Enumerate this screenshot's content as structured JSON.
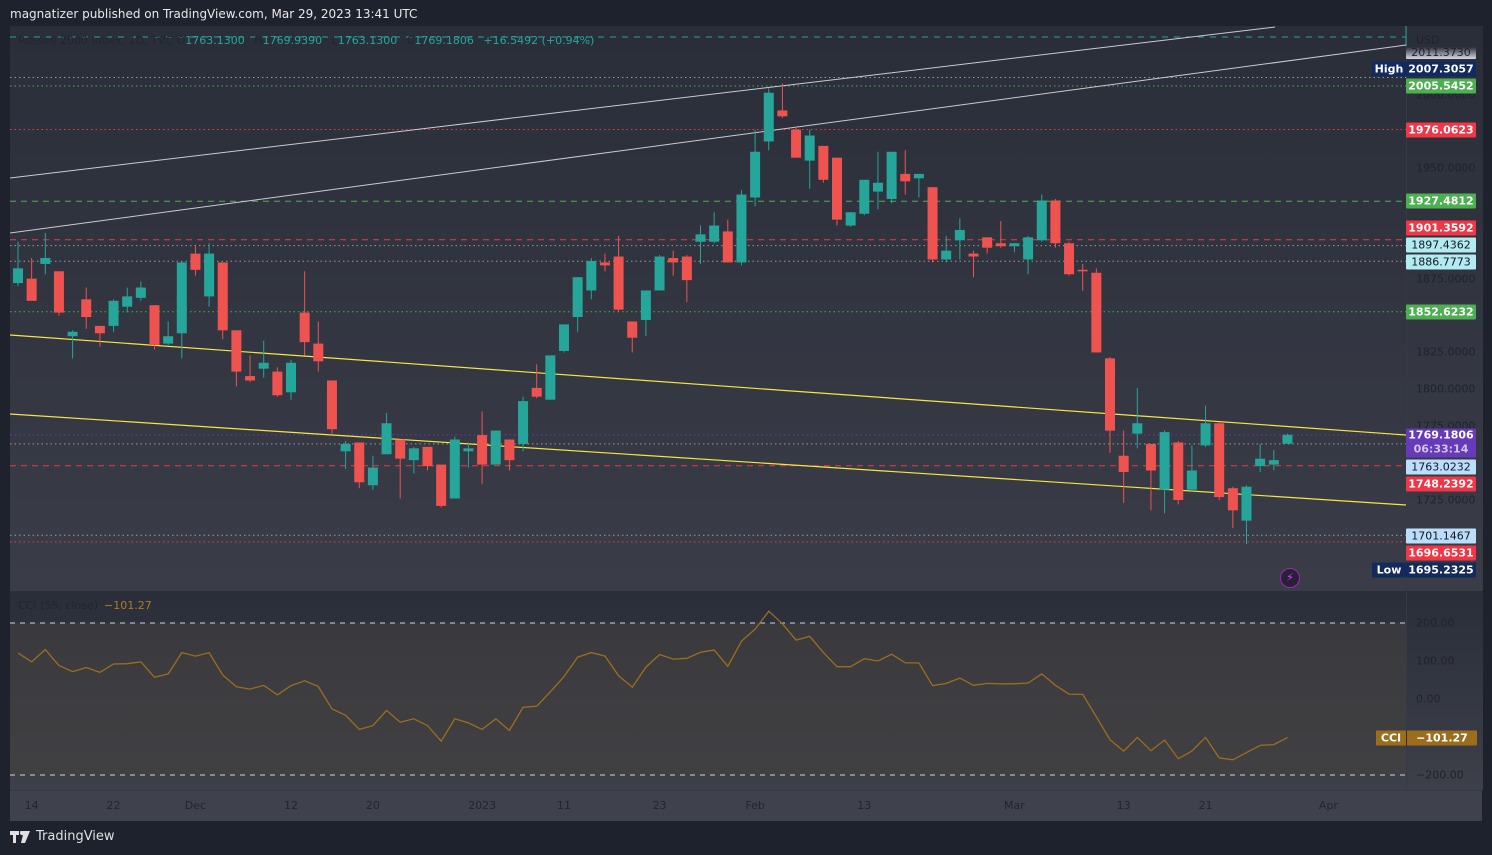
{
  "header": {
    "publish_text": "magnatizer published on TradingView.com, Mar 29, 2023 13:41 UTC"
  },
  "legend": {
    "symbol": "Russell 2000 Index, 1D, TVC",
    "o_label": "O",
    "open": "1763.1300",
    "h_label": "H",
    "high": "1769.9390",
    "l_label": "L",
    "low": "1763.1300",
    "c_label": "C",
    "close": "1769.1806",
    "change": "+16.5492 (+0.94%)"
  },
  "price_axis": {
    "currency": "USD",
    "ticks": [
      "2011.3730",
      "2000.0000",
      "1950.0000",
      "1875.0000",
      "1825.0000",
      "1800.0000",
      "1775.0000",
      "1725.0000"
    ],
    "badges": {
      "high_tag": "High",
      "high": "2007.3057",
      "b2005": "2005.5452",
      "b1976": "1976.0623",
      "b1927": "1927.4812",
      "b1901": "1901.3592",
      "b1897": "1897.4362",
      "b1886": "1886.7773",
      "b1852": "1852.6232",
      "last": "1769.1806",
      "countdown": "06:33:14",
      "b1763": "1763.0232",
      "b1748": "1748.2392",
      "b1701": "1701.1467",
      "b1696": "1696.6531",
      "low_tag": "Low",
      "low": "1695.2325"
    }
  },
  "colors": {
    "up": "#26a69a",
    "down": "#ef5350",
    "cci": "#9c6d1c",
    "accent_purple": "#673ab7"
  },
  "cci": {
    "legend_label": "CCI (55, close)",
    "legend_value": "−101.27",
    "axis_ticks": [
      "200.00",
      "100.00",
      "0.00",
      "−200.00"
    ],
    "badge_tag": "CCI",
    "badge_value": "−101.27"
  },
  "time_axis": {
    "labels": [
      {
        "text": "14",
        "index": 1
      },
      {
        "text": "22",
        "index": 7
      },
      {
        "text": "Dec",
        "index": 13
      },
      {
        "text": "12",
        "index": 20
      },
      {
        "text": "20",
        "index": 26
      },
      {
        "text": "2023",
        "index": 34
      },
      {
        "text": "11",
        "index": 40
      },
      {
        "text": "23",
        "index": 47
      },
      {
        "text": "Feb",
        "index": 54
      },
      {
        "text": "13",
        "index": 62
      },
      {
        "text": "Mar",
        "index": 73
      },
      {
        "text": "13",
        "index": 81
      },
      {
        "text": "21",
        "index": 87
      },
      {
        "text": "Apr",
        "index": 96
      }
    ]
  },
  "footer": {
    "brand": "TradingView"
  },
  "chart_data": {
    "type": "candlestick",
    "title": "Russell 2000 Index, 1D, TVC",
    "ylabel": "USD",
    "ylim": [
      1680,
      2040
    ],
    "levels": [
      {
        "price": 2011.373,
        "color": "#9598a1",
        "style": "dotted"
      },
      {
        "price": 2005.5452,
        "color": "#4caf50",
        "style": "dotted"
      },
      {
        "price": 1976.0623,
        "color": "#f23645",
        "style": "dotted"
      },
      {
        "price": 1927.4812,
        "color": "#4caf50",
        "style": "dashed"
      },
      {
        "price": 1901.3592,
        "color": "#f23645",
        "style": "dashed"
      },
      {
        "price": 1897.4362,
        "color": "#9598a1",
        "style": "dotted"
      },
      {
        "price": 1886.7773,
        "color": "#9598a1",
        "style": "dotted"
      },
      {
        "price": 1852.6232,
        "color": "#4caf50",
        "style": "dotted"
      },
      {
        "price": 1769.1806,
        "color": "#673ab7",
        "style": "dotted"
      },
      {
        "price": 1763.0232,
        "color": "#9598a1",
        "style": "dotted"
      },
      {
        "price": 1748.2392,
        "color": "#f23645",
        "style": "dashed"
      },
      {
        "price": 1701.1467,
        "color": "#9598a1",
        "style": "dotted"
      },
      {
        "price": 1696.6531,
        "color": "#f23645",
        "style": "dotted"
      }
    ],
    "ohlc": [
      [
        1872,
        1900,
        1870,
        1882
      ],
      [
        1875,
        1889,
        1860,
        1860
      ],
      [
        1885,
        1906,
        1878,
        1889
      ],
      [
        1880,
        1880,
        1850,
        1852
      ],
      [
        1836,
        1840,
        1821,
        1839
      ],
      [
        1861,
        1869,
        1841,
        1849
      ],
      [
        1843,
        1843,
        1829,
        1838
      ],
      [
        1843,
        1861,
        1839,
        1860
      ],
      [
        1856,
        1869,
        1852,
        1863
      ],
      [
        1862,
        1873,
        1860,
        1869
      ],
      [
        1857,
        1857,
        1827,
        1830
      ],
      [
        1831,
        1846,
        1830,
        1836
      ],
      [
        1838,
        1887,
        1821,
        1886
      ],
      [
        1892,
        1898,
        1877,
        1881
      ],
      [
        1863,
        1899,
        1856,
        1892
      ],
      [
        1886,
        1886,
        1834,
        1840
      ],
      [
        1840,
        1840,
        1802,
        1812
      ],
      [
        1809,
        1823,
        1805,
        1806
      ],
      [
        1814,
        1833,
        1808,
        1818
      ],
      [
        1812,
        1815,
        1795,
        1796
      ],
      [
        1798,
        1820,
        1793,
        1818
      ],
      [
        1852,
        1880,
        1823,
        1832
      ],
      [
        1831,
        1846,
        1812,
        1819
      ],
      [
        1806,
        1806,
        1770,
        1773
      ],
      [
        1758,
        1765,
        1746,
        1763
      ],
      [
        1764,
        1764,
        1733,
        1737
      ],
      [
        1735,
        1755,
        1732,
        1747
      ],
      [
        1756,
        1784,
        1756,
        1777
      ],
      [
        1766,
        1766,
        1726,
        1753
      ],
      [
        1752,
        1761,
        1743,
        1760
      ],
      [
        1761,
        1761,
        1745,
        1748
      ],
      [
        1749,
        1749,
        1720,
        1721
      ],
      [
        1726,
        1768,
        1726,
        1766
      ],
      [
        1758,
        1764,
        1747,
        1760
      ],
      [
        1769,
        1785,
        1736,
        1749
      ],
      [
        1749,
        1772,
        1749,
        1772
      ],
      [
        1766,
        1766,
        1745,
        1752
      ],
      [
        1763,
        1795,
        1758,
        1792
      ],
      [
        1801,
        1817,
        1794,
        1795
      ],
      [
        1793,
        1823,
        1793,
        1823
      ],
      [
        1826,
        1844,
        1825,
        1844
      ],
      [
        1849,
        1876,
        1839,
        1876
      ],
      [
        1867,
        1889,
        1861,
        1887
      ],
      [
        1886,
        1892,
        1880,
        1884
      ],
      [
        1890,
        1904,
        1853,
        1854
      ],
      [
        1846,
        1846,
        1825,
        1835
      ],
      [
        1847,
        1867,
        1836,
        1867
      ],
      [
        1867,
        1891,
        1867,
        1890
      ],
      [
        1889,
        1894,
        1877,
        1886
      ],
      [
        1890,
        1891,
        1859,
        1874
      ],
      [
        1900,
        1911,
        1885,
        1905
      ],
      [
        1900,
        1920,
        1899,
        1911
      ],
      [
        1907,
        1915,
        1886,
        1886
      ],
      [
        1886,
        1935,
        1884,
        1932
      ],
      [
        1930,
        1976,
        1924,
        1961
      ],
      [
        1968,
        2004,
        1962,
        2001
      ],
      [
        1989,
        2007.3,
        1984,
        1985
      ],
      [
        1976,
        1978,
        1957,
        1957
      ],
      [
        1955,
        1976,
        1936,
        1972
      ],
      [
        1965,
        1965,
        1940,
        1942
      ],
      [
        1957,
        1957,
        1911,
        1915
      ],
      [
        1911,
        1920,
        1910,
        1920
      ],
      [
        1919,
        1942,
        1918,
        1942
      ],
      [
        1934,
        1961,
        1922,
        1940
      ],
      [
        1929,
        1961,
        1926,
        1961
      ],
      [
        1946,
        1962,
        1932,
        1941
      ],
      [
        1943,
        1946,
        1930,
        1946
      ],
      [
        1937,
        1937,
        1886,
        1888
      ],
      [
        1888,
        1904,
        1886,
        1894
      ],
      [
        1901,
        1916,
        1888,
        1908
      ],
      [
        1892,
        1894,
        1876,
        1890
      ],
      [
        1903,
        1903,
        1892,
        1896
      ],
      [
        1899,
        1914,
        1896,
        1897
      ],
      [
        1897,
        1899,
        1893,
        1899
      ],
      [
        1888,
        1904,
        1878,
        1903
      ],
      [
        1901,
        1932,
        1900,
        1928
      ],
      [
        1928,
        1929,
        1896,
        1899
      ],
      [
        1899,
        1900,
        1877,
        1878
      ],
      [
        1881,
        1885,
        1867,
        1880
      ],
      [
        1879,
        1882,
        1825,
        1825
      ],
      [
        1821,
        1822,
        1757,
        1772
      ],
      [
        1755,
        1772,
        1723,
        1744
      ],
      [
        1770,
        1801,
        1760,
        1777
      ],
      [
        1763,
        1763,
        1718,
        1745
      ],
      [
        1732,
        1772,
        1716,
        1771
      ],
      [
        1764,
        1765,
        1722,
        1725
      ],
      [
        1732,
        1762,
        1731,
        1745
      ],
      [
        1762,
        1789,
        1761,
        1777
      ],
      [
        1777,
        1778,
        1725,
        1727
      ],
      [
        1733,
        1734,
        1706,
        1718
      ],
      [
        1711,
        1735,
        1695.2,
        1734
      ],
      [
        1748,
        1763,
        1744,
        1753
      ],
      [
        1749,
        1759,
        1745,
        1752
      ],
      [
        1763.13,
        1769.94,
        1763.13,
        1769.18
      ]
    ],
    "cci_series": {
      "name": "CCI (55, close)",
      "ylim": [
        -200,
        200
      ],
      "values": [
        121,
        98,
        130,
        88,
        72,
        83,
        70,
        92,
        93,
        98,
        57,
        66,
        122,
        113,
        122,
        63,
        32,
        26,
        36,
        11,
        35,
        48,
        33,
        -26,
        -43,
        -80,
        -70,
        -30,
        -61,
        -52,
        -70,
        -111,
        -52,
        -63,
        -80,
        -52,
        -83,
        -22,
        -19,
        19,
        59,
        110,
        122,
        113,
        61,
        31,
        84,
        117,
        105,
        107,
        123,
        129,
        86,
        152,
        184,
        231,
        198,
        155,
        165,
        122,
        85,
        85,
        106,
        100,
        118,
        95,
        95,
        35,
        41,
        55,
        36,
        41,
        40,
        40,
        42,
        66,
        36,
        13,
        12,
        -47,
        -107,
        -137,
        -101,
        -136,
        -108,
        -157,
        -137,
        -101,
        -155,
        -160,
        -141,
        -122,
        -120,
        -101.27
      ]
    }
  }
}
